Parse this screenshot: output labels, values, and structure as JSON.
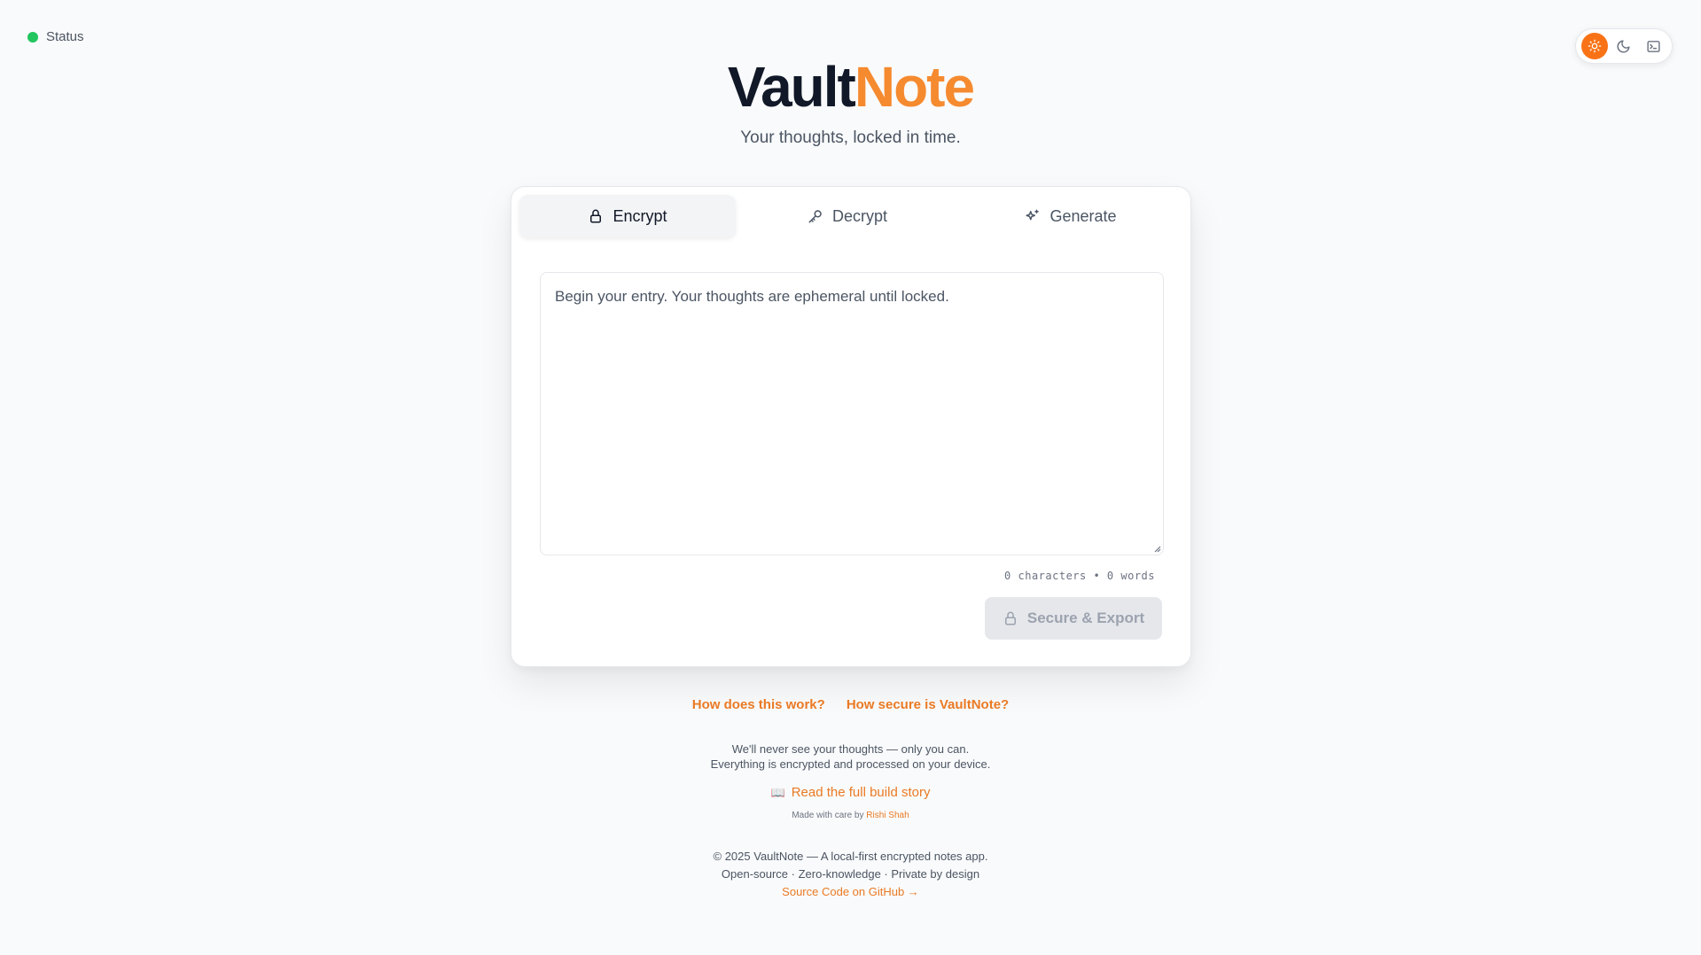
{
  "status": {
    "label": "Status",
    "color": "#22c55e"
  },
  "theme": {
    "options": [
      "light-icon",
      "dark-icon",
      "terminal-icon"
    ],
    "active": "light",
    "accent": "#f97316"
  },
  "header": {
    "brand_part1": "Vault",
    "brand_part2": "Note",
    "tagline": "Your thoughts, locked in time."
  },
  "tabs": [
    {
      "label": "Encrypt",
      "icon": "lock-icon",
      "active": true
    },
    {
      "label": "Decrypt",
      "icon": "key-icon",
      "active": false
    },
    {
      "label": "Generate",
      "icon": "sparkles-icon",
      "active": false
    }
  ],
  "editor": {
    "placeholder": "Begin your entry. Your thoughts are ephemeral until locked.",
    "value": ""
  },
  "counter": {
    "text": "0 characters • 0 words"
  },
  "secure_button": {
    "label": "Secure & Export",
    "icon": "lock-icon",
    "disabled": true
  },
  "help_links": [
    "How does this work?",
    "How secure is VaultNote?"
  ],
  "privacy": {
    "line1": "We'll never see your thoughts — only you can.",
    "line2": "Everything is encrypted and processed on your device."
  },
  "build_story": {
    "label": "Read the full build story",
    "icon": "📖"
  },
  "made_with": {
    "prefix": "Made with care by ",
    "author": "Rishi Shah"
  },
  "footer": {
    "copyright": "© 2025 VaultNote — A local-first encrypted notes app.",
    "tags": "Open-source · Zero-knowledge · Private by design",
    "github": "Source Code on GitHub →"
  },
  "colors": {
    "brand_dark": "#111827",
    "brand_accent": "#f58a2f",
    "link": "#ea7a24"
  }
}
